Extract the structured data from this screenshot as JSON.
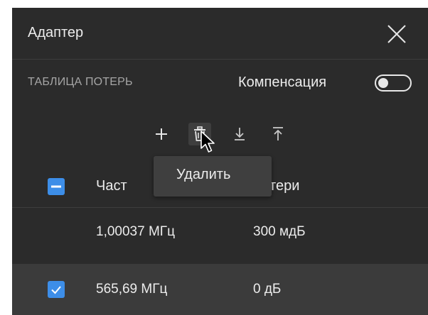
{
  "dialog": {
    "title": "Адаптер",
    "close_icon": "close-icon"
  },
  "loss_table": {
    "section_label": "ТАБЛИЦА ПОТЕРЬ",
    "compensation_label": "Компенсация",
    "compensation_enabled": false,
    "toolbar": {
      "add_icon": "plus-icon",
      "delete_icon": "trash-icon",
      "import_icon": "download-icon",
      "export_icon": "upload-icon"
    },
    "tooltip": "Удалить",
    "columns": {
      "frequency": "Частота",
      "frequency_visible": "Част",
      "loss": "Потери",
      "loss_visible": "Потери"
    },
    "rows": [
      {
        "selected": false,
        "frequency": "1,00037 МГц",
        "loss": "300 мдБ"
      },
      {
        "selected": true,
        "frequency": "565,69 МГц",
        "loss": "0 дБ"
      }
    ]
  },
  "colors": {
    "panel_bg": "#2b2b2b",
    "selected_row_bg": "#3b3b3b",
    "accent": "#3d8ee8",
    "text": "#ececec",
    "muted_text": "#a6a6a6"
  }
}
